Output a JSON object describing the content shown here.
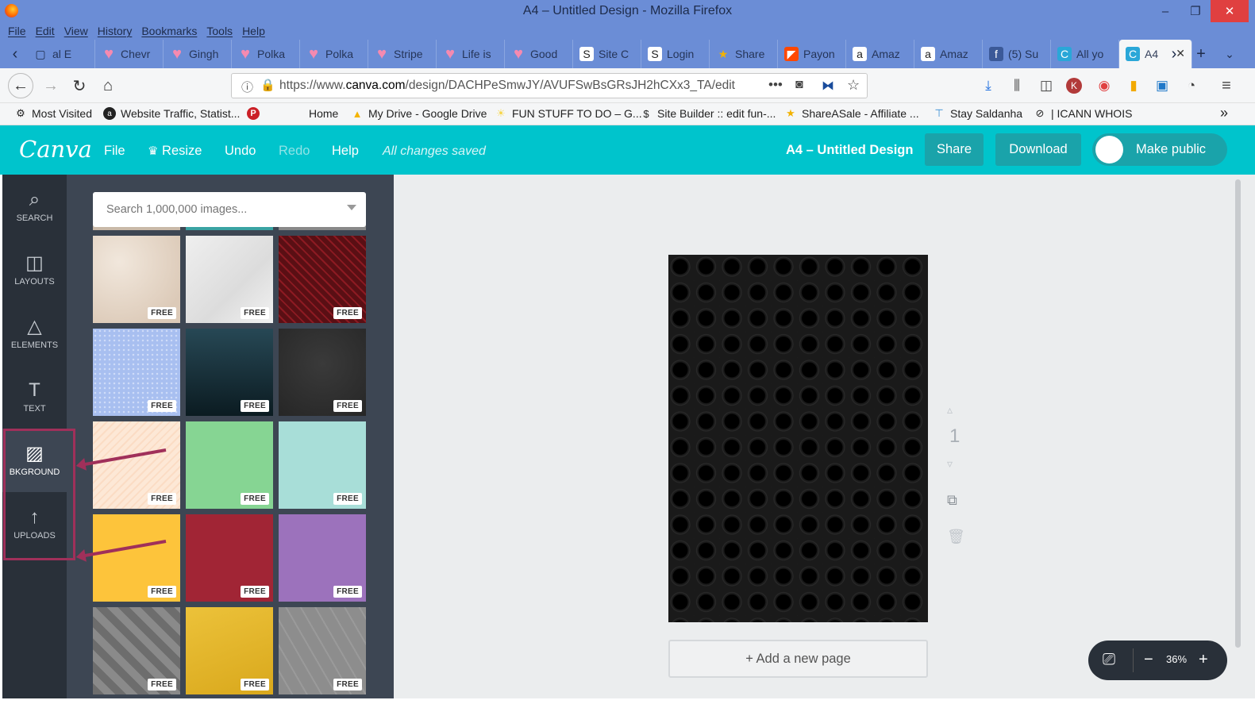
{
  "window": {
    "title": "A4 – Untitled Design - Mozilla Firefox",
    "minimize": "–",
    "restore": "❐",
    "close": "✕"
  },
  "menubar": [
    "File",
    "Edit",
    "View",
    "History",
    "Bookmarks",
    "Tools",
    "Help"
  ],
  "tabs": [
    {
      "label": "al E",
      "icon": "page-icon",
      "active": false
    },
    {
      "label": "Chevr",
      "icon": "heart-icon",
      "active": false
    },
    {
      "label": "Gingh",
      "icon": "heart-icon",
      "active": false
    },
    {
      "label": "Polka",
      "icon": "heart-icon",
      "active": false
    },
    {
      "label": "Polka",
      "icon": "heart-icon",
      "active": false
    },
    {
      "label": "Stripe",
      "icon": "heart-icon",
      "active": false
    },
    {
      "label": "Life is",
      "icon": "heart-icon",
      "active": false
    },
    {
      "label": "Good",
      "icon": "heart-icon",
      "active": false
    },
    {
      "label": "Site C",
      "icon": "site-builder-icon",
      "active": false
    },
    {
      "label": "Login",
      "icon": "site-builder-icon",
      "active": false
    },
    {
      "label": "Share",
      "icon": "star-icon",
      "active": false
    },
    {
      "label": "Payon",
      "icon": "payoneer-icon",
      "active": false
    },
    {
      "label": "Amaz",
      "icon": "amazon-icon",
      "active": false
    },
    {
      "label": "Amaz",
      "icon": "amazon-icon",
      "active": false
    },
    {
      "label": "(5) Su",
      "icon": "facebook-icon",
      "active": false
    },
    {
      "label": "All yo",
      "icon": "canva-icon",
      "active": false
    },
    {
      "label": "A4",
      "icon": "canva-icon",
      "active": true
    }
  ],
  "nav": {
    "url_prefix": "https://www.",
    "url_domain": "canva.com",
    "url_path": "/design/DACHPeSmwJY/AVUFSwBsGRsJH2hCXx3_TA/edit"
  },
  "bookmarks": [
    {
      "label": "Most Visited",
      "icon": "gear-icon"
    },
    {
      "label": "Website Traffic, Statist...",
      "icon": "similarweb-icon"
    },
    {
      "label": "",
      "icon": "pinterest-icon"
    },
    {
      "label": "Home",
      "icon": ""
    },
    {
      "label": "My Drive - Google Drive",
      "icon": "google-drive-icon"
    },
    {
      "label": "FUN STUFF TO DO – G...",
      "icon": "sun-icon"
    },
    {
      "label": "Site Builder :: edit fun-...",
      "icon": "site-builder-icon"
    },
    {
      "label": "ShareASale - Affiliate ...",
      "icon": "star-icon"
    },
    {
      "label": "Stay Saldanha",
      "icon": "pin-icon"
    },
    {
      "label": "| ICANN WHOIS",
      "icon": "whois-icon"
    }
  ],
  "canva": {
    "logo": "Canva",
    "menu": {
      "file": "File",
      "resize": "Resize",
      "undo": "Undo",
      "redo": "Redo",
      "help": "Help"
    },
    "save_status": "All changes saved",
    "design_title": "A4 – Untitled Design",
    "share": "Share",
    "download": "Download",
    "make_public": "Make public"
  },
  "rail": [
    {
      "label": "SEARCH",
      "icon": "search-icon",
      "active": false
    },
    {
      "label": "LAYOUTS",
      "icon": "layouts-icon",
      "active": false
    },
    {
      "label": "ELEMENTS",
      "icon": "elements-icon",
      "active": false
    },
    {
      "label": "TEXT",
      "icon": "text-icon",
      "active": false
    },
    {
      "label": "BKGROUND",
      "icon": "background-icon",
      "active": true
    },
    {
      "label": "UPLOADS",
      "icon": "upload-icon",
      "active": false
    }
  ],
  "panel": {
    "search_placeholder": "Search 1,000,000 images...",
    "free_badge": "FREE",
    "backgrounds": [
      {
        "name": "beige-texture",
        "color": "#e6d9cc"
      },
      {
        "name": "white-marble",
        "color": "#e8e8e8"
      },
      {
        "name": "red-chevron",
        "color": "#5a0f14"
      },
      {
        "name": "blue-dots",
        "color": "#a8bff0"
      },
      {
        "name": "dark-teal-gradient",
        "color": "#17313b"
      },
      {
        "name": "dark-grey",
        "color": "#2e2e2e"
      },
      {
        "name": "peach-stripes",
        "color": "#fde8d6"
      },
      {
        "name": "mint-green",
        "color": "#86d593"
      },
      {
        "name": "aqua",
        "color": "#a8ded8"
      },
      {
        "name": "yellow",
        "color": "#fdc43b"
      },
      {
        "name": "crimson",
        "color": "#a12535"
      },
      {
        "name": "purple",
        "color": "#9c72bc"
      },
      {
        "name": "grey-zigzag",
        "color": "#7d7d7d"
      },
      {
        "name": "yellow-crack",
        "color": "#e2b326"
      },
      {
        "name": "grey-hexagon",
        "color": "#8d8d8d"
      }
    ]
  },
  "workspace": {
    "page_number": "1",
    "add_page": "+ Add a new page",
    "zoom": "36%"
  },
  "colors": {
    "canva_teal": "#00c4cc",
    "rail_bg": "#293039",
    "panel_bg": "#3d4653",
    "annotation": "#a0305a"
  }
}
